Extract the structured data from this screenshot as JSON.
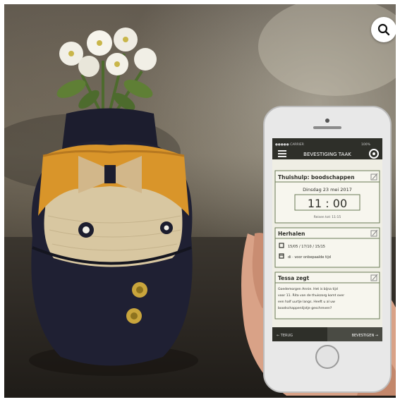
{
  "phone": {
    "status_carrier": "●●●●● CARRIER",
    "status_battery": "100%",
    "header_title": "BEVESTIGING TAAK",
    "card1": {
      "title": "Thuishulp: boodschappen",
      "date": "Dinsdag 23 mei 2017",
      "time": "11 : 00",
      "reminder": "Reisen tot: 11:15"
    },
    "card2": {
      "title": "Herhalen",
      "line1": "15/05 / 17/10 / 15/15",
      "line2": "di · voor onbepaalde tijd"
    },
    "card3": {
      "title": "Tessa zegt",
      "body1": "Goedemorgen Annie. Het is bijna tijd",
      "body2": "voor 11. Rita van de thuiszorg komt over",
      "body3": "een half uurtje langs. Heeft u al uw",
      "body4": "boodschappenlijstje geschreven?"
    },
    "footer_back": "← TERUG",
    "footer_confirm": "BEVESTIGEN →"
  },
  "icons": {
    "zoom": "magnifier-icon",
    "menu": "hamburger-menu-icon",
    "settings": "settings-icon",
    "edit": "pencil-edit-icon",
    "repeat": "repeat-icon",
    "calendar": "calendar-icon"
  },
  "colors": {
    "robot_body": "#1f2033",
    "robot_scarf": "#d9952a",
    "robot_face": "#d8c7a1",
    "phone_body": "#e8e8e8",
    "screen_bg": "#efeee4",
    "header_bg": "#2e2f29",
    "accent_green": "#6a7a55"
  }
}
